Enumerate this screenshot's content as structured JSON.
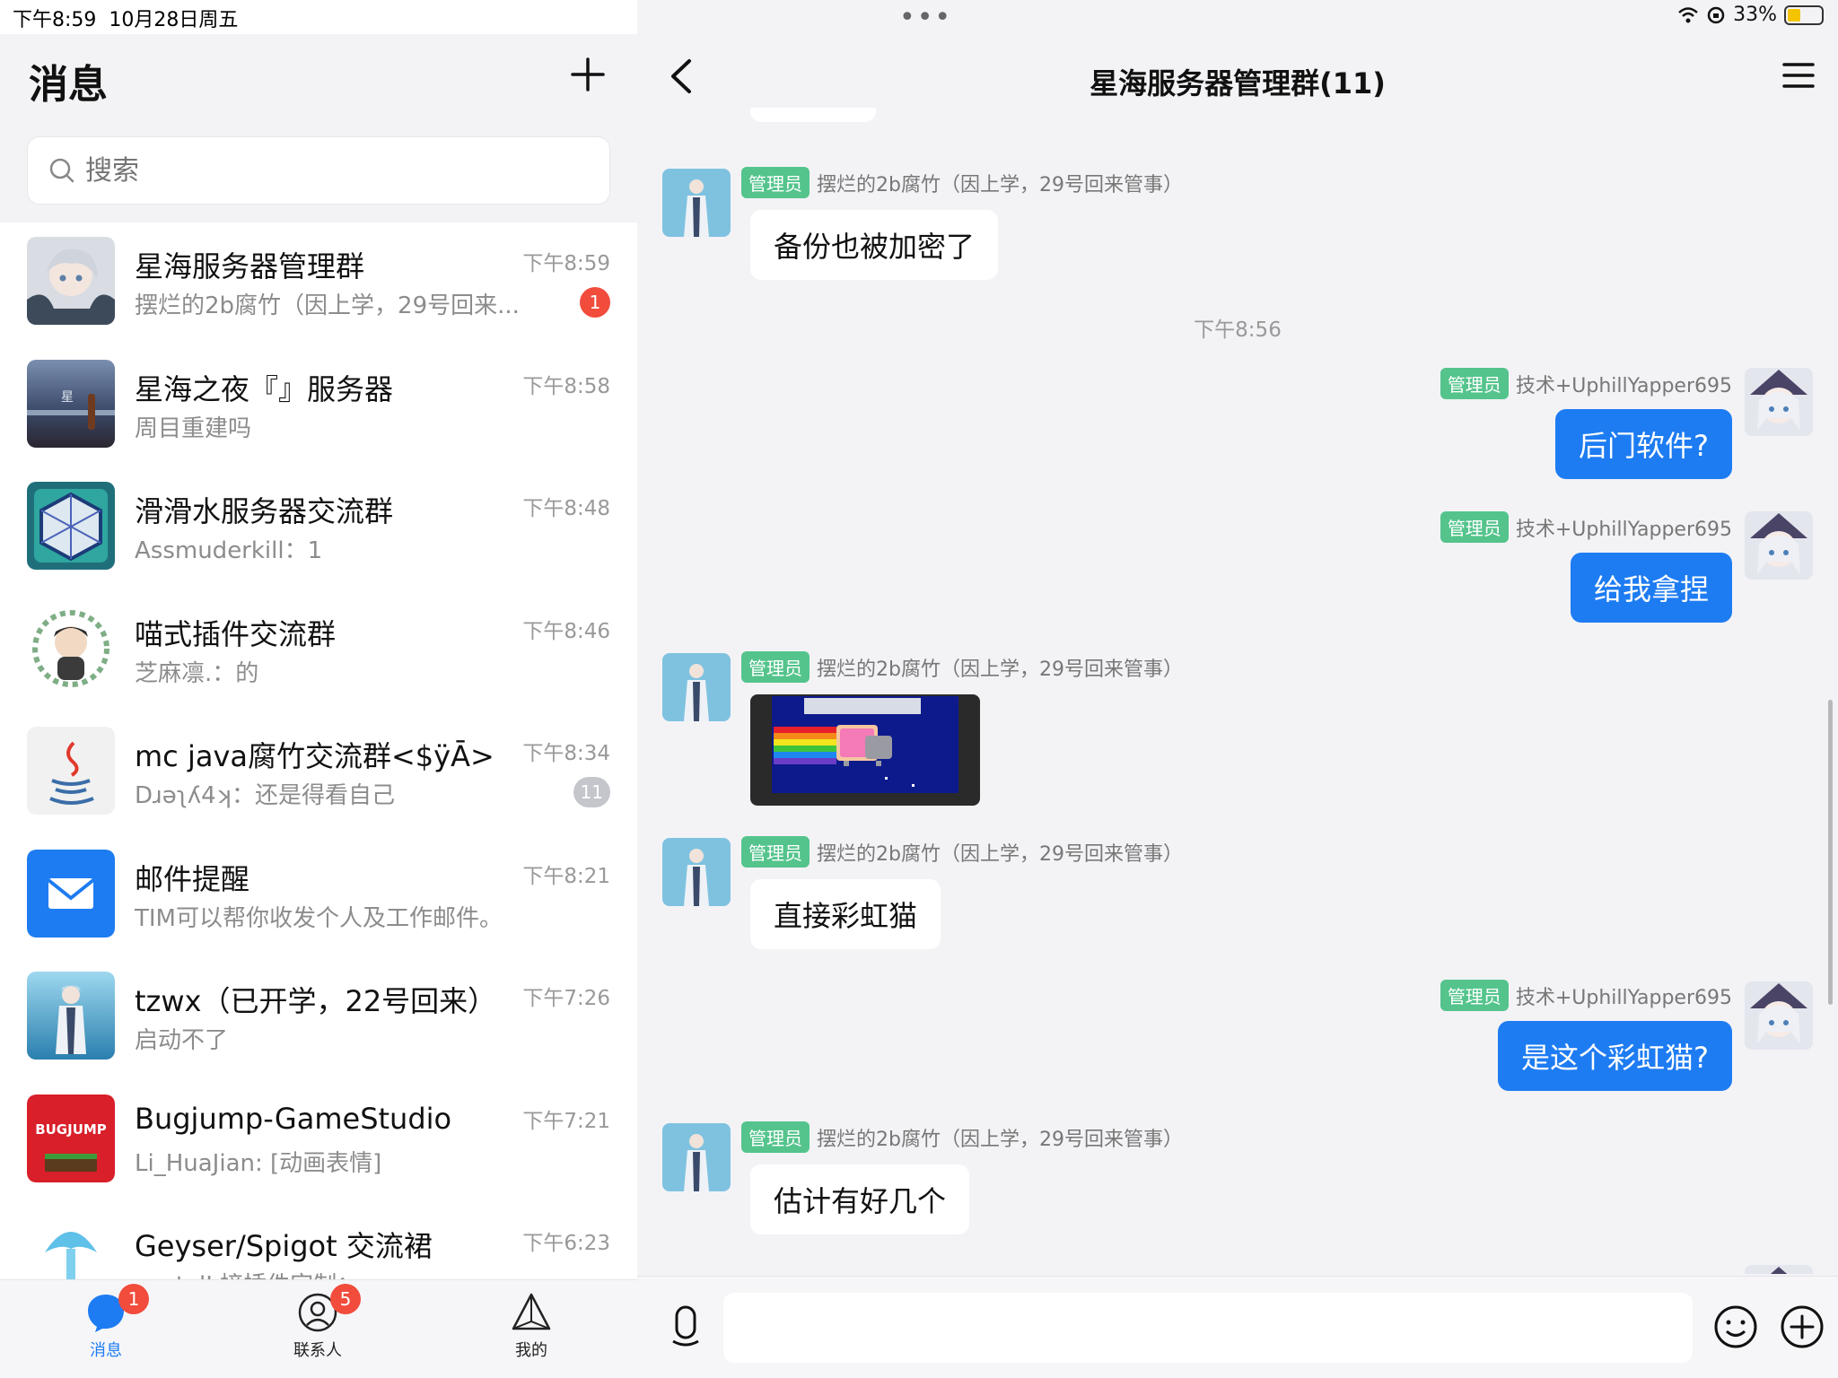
{
  "status_bar": {
    "time": "下午8:59",
    "date": "10月28日周五",
    "battery": "33%",
    "multitask_dots": "•••"
  },
  "left": {
    "title": "消息",
    "search_placeholder": "搜索",
    "conversations": [
      {
        "name": "星海服务器管理群",
        "time": "下午8:59",
        "preview": "摆烂的2b腐竹（因上学，29号回来...",
        "badge": "1",
        "badge_type": "red",
        "avatar_color": "#8d96a3"
      },
      {
        "name": "星海之夜『』服务器",
        "time": "下午8:58",
        "preview": "周目重建吗",
        "badge": "",
        "badge_type": "",
        "avatar_color": "#4a5a78"
      },
      {
        "name": "滑滑水服务器交流群",
        "time": "下午8:48",
        "preview": "Assmuderkill：1",
        "badge": "",
        "badge_type": "",
        "avatar_color": "#2e8d8a"
      },
      {
        "name": "喵式插件交流群",
        "time": "下午8:46",
        "preview": "芝麻凛.：的",
        "badge": "",
        "badge_type": "",
        "avatar_color": "#dfe6dc"
      },
      {
        "name": "mc java腐竹交流群<$ÿĀ>",
        "time": "下午8:34",
        "preview": "Dɹǝʅʎ4ʞ：还是得看自己",
        "badge": "11",
        "badge_type": "gray",
        "avatar_color": "#eeeeee"
      },
      {
        "name": "邮件提醒",
        "time": "下午8:21",
        "preview": "TIM可以帮你收发个人及工作邮件。",
        "badge": "",
        "badge_type": "",
        "avatar_color": "#1e7cf2"
      },
      {
        "name": "tzwx（已开学，22号回来）",
        "time": "下午7:26",
        "preview": "启动不了",
        "badge": "",
        "badge_type": "",
        "avatar_color": "#5fb6d8"
      },
      {
        "name": "Bugjump-GameStudio",
        "time": "下午7:21",
        "preview": "Li_HuaJian: [动画表情]",
        "badge": "",
        "badge_type": "",
        "avatar_color": "#d81f2a"
      },
      {
        "name": "Geyser/Spigot 交流裙",
        "time": "下午6:23",
        "preview": "nostalI 接插件定制：",
        "badge": "",
        "badge_type": "",
        "avatar_color": "#5fc0e8"
      }
    ],
    "bugjump_logo": "BUGJUMP",
    "tabs": [
      {
        "label": "消息",
        "badge": "1"
      },
      {
        "label": "联系人",
        "badge": "5"
      },
      {
        "label": "我的",
        "badge": ""
      }
    ]
  },
  "chat": {
    "title": "星海服务器管理群(11)",
    "admin_tag": "管理员",
    "sender_a": "摆烂的2b腐竹（因上学，29号回来管事）",
    "sender_b": "技术+UphillYapper695",
    "messages": [
      {
        "text": "备份也被加密了"
      },
      {
        "text": "后门软件?"
      },
      {
        "text": "给我拿捏"
      },
      {
        "text": "直接彩虹猫"
      },
      {
        "text": "是这个彩虹猫?"
      },
      {
        "text": "估计有好几个"
      }
    ],
    "time_divider": "下午8:56",
    "input_value": ""
  },
  "colors": {
    "accent_blue": "#1e7cf2",
    "admin_green": "#54c48c",
    "badge_red": "#f14c3c"
  }
}
